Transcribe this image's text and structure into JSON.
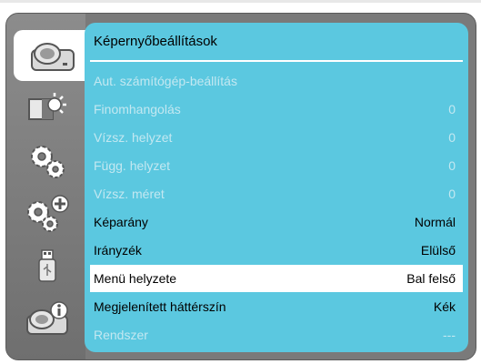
{
  "menu": {
    "title": "Képernyőbeállítások",
    "items": [
      {
        "label": "Aut. számítógép-beállítás",
        "value": "",
        "enabled": false,
        "selected": false
      },
      {
        "label": "Finomhangolás",
        "value": "0",
        "enabled": false,
        "selected": false
      },
      {
        "label": "Vízsz. helyzet",
        "value": "0",
        "enabled": false,
        "selected": false
      },
      {
        "label": "Függ. helyzet",
        "value": "0",
        "enabled": false,
        "selected": false
      },
      {
        "label": "Vízsz. méret",
        "value": "0",
        "enabled": false,
        "selected": false
      },
      {
        "label": "Képarány",
        "value": "Normál",
        "enabled": true,
        "selected": false
      },
      {
        "label": "Irányzék",
        "value": "Elülső",
        "enabled": true,
        "selected": false
      },
      {
        "label": "Menü helyzete",
        "value": "Bal felső",
        "enabled": true,
        "selected": true
      },
      {
        "label": "Megjelenített háttérszín",
        "value": "Kék",
        "enabled": true,
        "selected": false
      },
      {
        "label": "Rendszer",
        "value": "---",
        "enabled": false,
        "selected": false
      }
    ]
  },
  "sidebar": {
    "tabs": [
      {
        "icon": "projector-icon",
        "active": true
      },
      {
        "icon": "picture-brightness-icon",
        "active": false
      },
      {
        "icon": "gear-icon",
        "active": false
      },
      {
        "icon": "gear-plus-icon",
        "active": false
      },
      {
        "icon": "usb-icon",
        "active": false
      },
      {
        "icon": "projector-info-icon",
        "active": false
      }
    ]
  },
  "colors": {
    "content_bg": "#5bc8e0",
    "disabled_text": "#c3e8f1",
    "selected_bg": "#ffffff",
    "sidebar_bg": "#7a7a7a"
  }
}
